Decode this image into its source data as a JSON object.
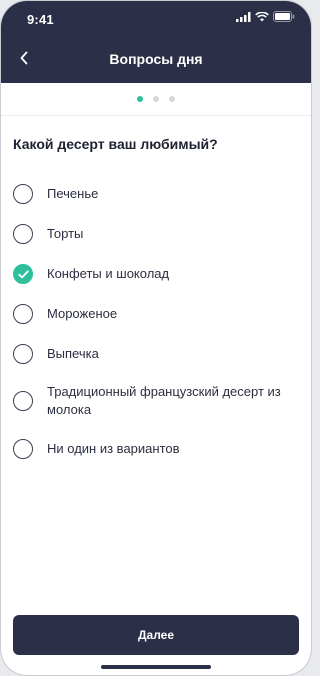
{
  "status_bar": {
    "time": "9:41"
  },
  "header": {
    "title": "Вопросы дня"
  },
  "pager": {
    "total": 3,
    "active_index": 0,
    "accent": "#2fbf9a"
  },
  "question": "Какой десерт ваш любимый?",
  "options": [
    {
      "label": "Печенье",
      "checked": false
    },
    {
      "label": "Торты",
      "checked": false
    },
    {
      "label": "Конфеты и шоколад",
      "checked": true
    },
    {
      "label": "Мороженое",
      "checked": false
    },
    {
      "label": "Выпечка",
      "checked": false
    },
    {
      "label": "Традиционный французский десерт из молока",
      "checked": false
    },
    {
      "label": "Ни один из вариантов",
      "checked": false
    }
  ],
  "footer": {
    "next_label": "Далее"
  },
  "colors": {
    "primary": "#2b2f48",
    "accent": "#2fbf9a"
  }
}
